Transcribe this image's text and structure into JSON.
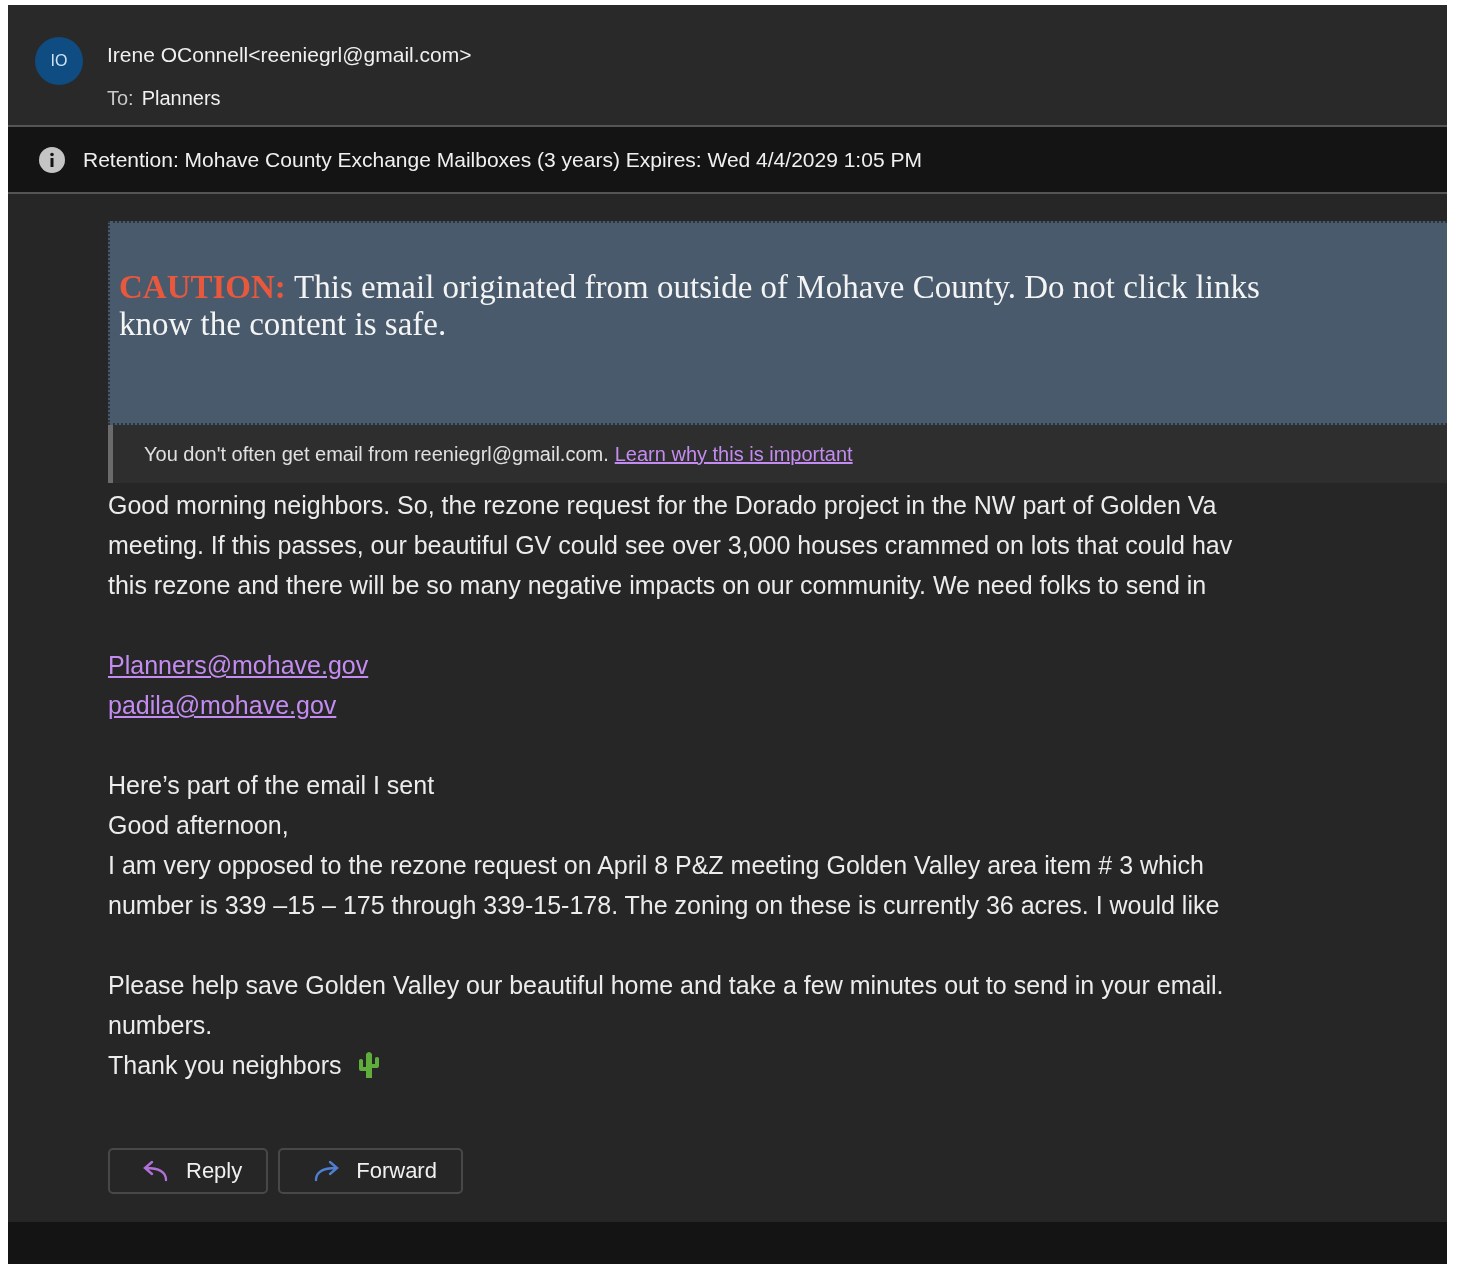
{
  "header": {
    "avatar_initials": "IO",
    "sender": "Irene OConnell<reeniegrl@gmail.com>",
    "to_label": "To:",
    "to_value": "Planners"
  },
  "retention": {
    "text": "Retention: Mohave County Exchange Mailboxes (3 years) Expires: Wed 4/4/2029 1:05 PM"
  },
  "caution": {
    "label": "CAUTION:",
    "lines": [
      "This email originated from outside of Mohave County. Do not click links",
      "know the content is safe."
    ]
  },
  "notice": {
    "text": "You don't often get email from reeniegrl@gmail.com.",
    "link": "Learn why this is important"
  },
  "body": [
    {
      "kind": "text",
      "text": "Good morning neighbors. So, the rezone request for the Dorado project in the NW part of Golden Va"
    },
    {
      "kind": "text",
      "text": "meeting. If this passes, our beautiful GV could see over 3,000 houses crammed on lots that could hav"
    },
    {
      "kind": "text",
      "text": "this rezone and there will be so many negative impacts on our community. We need folks to send in"
    },
    {
      "kind": "blank"
    },
    {
      "kind": "link",
      "text": "Planners@mohave.gov"
    },
    {
      "kind": "link",
      "text": "padila@mohave.gov"
    },
    {
      "kind": "blank"
    },
    {
      "kind": "text",
      "text": "Here’s part of the email I sent"
    },
    {
      "kind": "text",
      "text": "Good afternoon,"
    },
    {
      "kind": "text",
      "text": "I am very opposed to the rezone request on April 8 P&Z meeting Golden Valley area item # 3 which"
    },
    {
      "kind": "text",
      "text": "number is 339 –15 – 175 through 339-15-178. The zoning on these is currently 36 acres. I would like"
    },
    {
      "kind": "blank"
    },
    {
      "kind": "text",
      "text": "Please help save Golden Valley our beautiful home and take a few minutes out to send in your email."
    },
    {
      "kind": "text",
      "text": "numbers."
    },
    {
      "kind": "thanks",
      "text": "Thank you neighbors"
    }
  ],
  "actions": [
    {
      "kind": "reply",
      "label": "Reply"
    },
    {
      "kind": "forward",
      "label": "Forward"
    }
  ]
}
